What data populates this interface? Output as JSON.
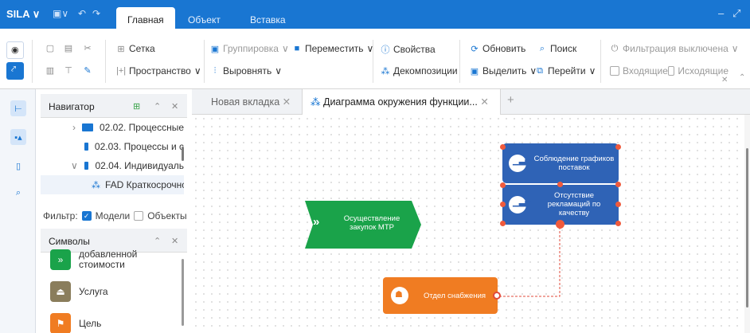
{
  "app": {
    "name": "SILA",
    "name_caret": "∨"
  },
  "ribbon_tabs": [
    {
      "label": "Главная"
    },
    {
      "label": "Объект"
    },
    {
      "label": "Вставка"
    }
  ],
  "ribbon": {
    "grid": "Сетка",
    "space": "Пространство",
    "group": "Группировка",
    "move": "Переместить",
    "align": "Выровнять",
    "properties": "Свойства",
    "decompositions": "Декомпозиции",
    "refresh": "Обновить",
    "search": "Поиск",
    "select": "Выделить",
    "goto": "Перейти",
    "filter_off": "Фильтрация выключена",
    "incoming": "Входящие",
    "outgoing": "Исходящие"
  },
  "navigator": {
    "title": "Навигатор",
    "items": [
      {
        "label": "02.02. Процессные"
      },
      {
        "label": "02.03. Процессы и с"
      },
      {
        "label": "02.04. Индивидуаль"
      },
      {
        "label": "FAD Краткосрочнс"
      }
    ]
  },
  "filter": {
    "label": "Фильтр:",
    "models": "Модели",
    "objects": "Объекты"
  },
  "symbols": {
    "title": "Символы",
    "items": [
      {
        "label": "добавленной стоимости",
        "color": "#1aa34a"
      },
      {
        "label": "Услуга",
        "color": "#8a7d5c"
      },
      {
        "label": "Цель",
        "color": "#f07c22"
      }
    ]
  },
  "doc_tabs": [
    {
      "label": "Новая вкладка"
    },
    {
      "label": "Диаграмма окружения функции..."
    }
  ],
  "diagram": {
    "nodes": [
      {
        "label": "Осуществление закупок МТР",
        "color": "#1aa34a"
      },
      {
        "label": "Соблюдение графиков поставок",
        "color": "#2f63b6"
      },
      {
        "label": "Отсутствие рекламаций по качеству",
        "color": "#2f63b6"
      },
      {
        "label": "Отдел снабжения",
        "color": "#f07c22"
      }
    ]
  }
}
